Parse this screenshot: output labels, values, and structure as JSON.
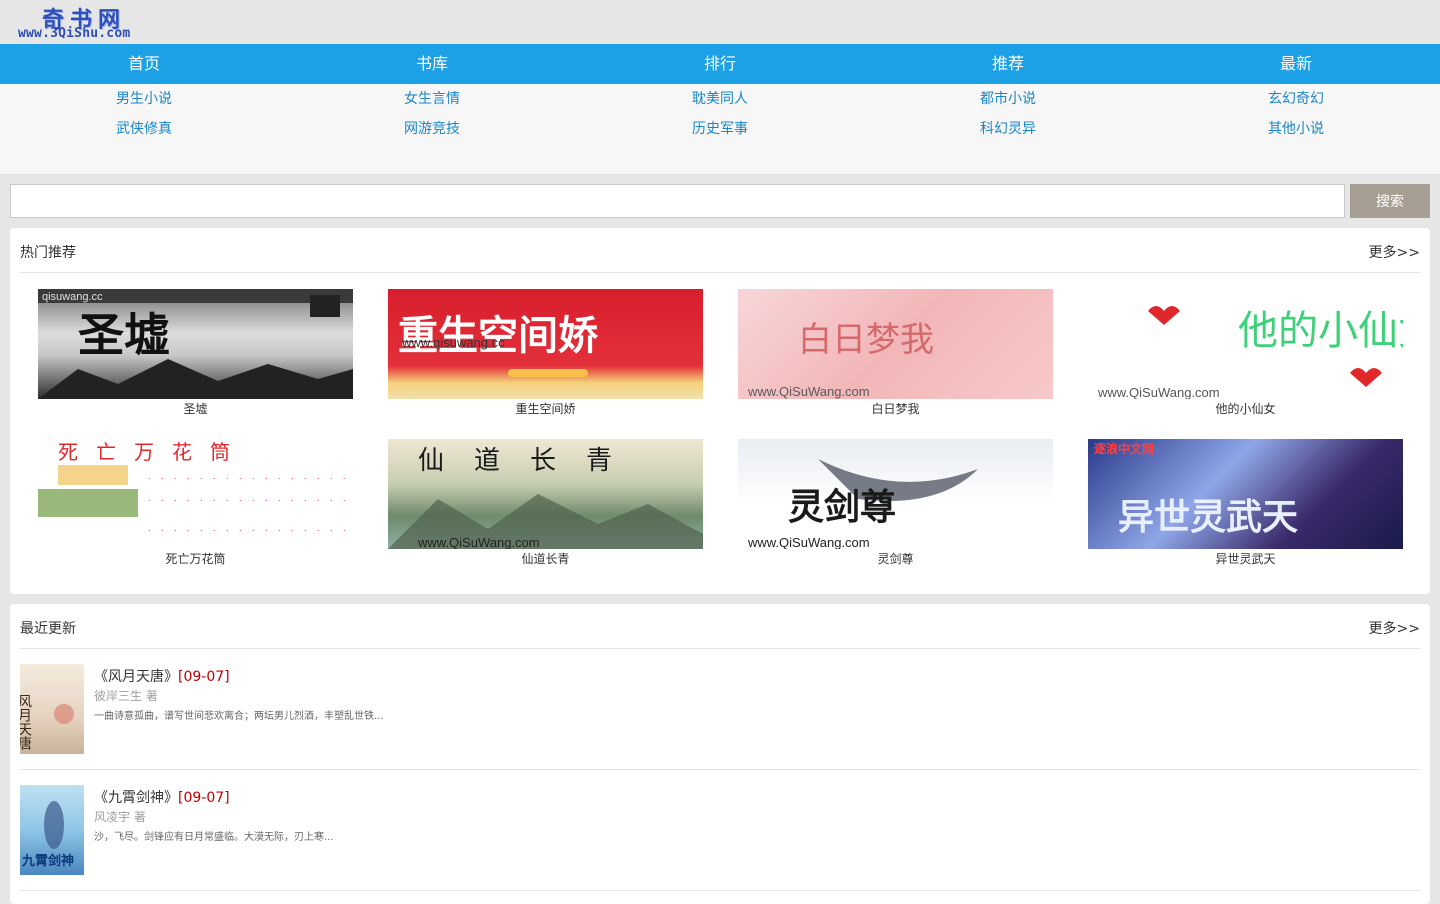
{
  "logo": {
    "cn": "奇书网",
    "url": "www.3QiShu.com"
  },
  "nav": [
    "首页",
    "书库",
    "排行",
    "推荐",
    "最新"
  ],
  "categories": [
    [
      "男生小说",
      "女生言情",
      "耽美同人",
      "都市小说",
      "玄幻奇幻"
    ],
    [
      "武侠修真",
      "网游竞技",
      "历史军事",
      "科幻灵异",
      "其他小说"
    ]
  ],
  "search": {
    "placeholder": "",
    "button": "搜索"
  },
  "hot": {
    "title": "热门推荐",
    "more": "更多>>",
    "books": [
      {
        "name": "圣墟",
        "cover_text": "圣墟",
        "cover_overlay": "qisuwang.cc"
      },
      {
        "name": "重生空间娇",
        "cover_text": "重生空间娇",
        "cover_overlay": "www.qisuwang.cc"
      },
      {
        "name": "白日梦我",
        "cover_text": "白日梦我",
        "cover_overlay": "www.QiSuWang.com"
      },
      {
        "name": "他的小仙女",
        "cover_text": "他的小仙女",
        "cover_overlay": "www.QiSuWang.com"
      },
      {
        "name": "死亡万花筒",
        "cover_text": "死亡万花筒",
        "cover_overlay": ""
      },
      {
        "name": "仙道长青",
        "cover_text": "仙道长青",
        "cover_overlay": "www.QiSuWang.com"
      },
      {
        "name": "灵剑尊",
        "cover_text": "灵剑尊",
        "cover_overlay": "www.QiSuWang.com"
      },
      {
        "name": "异世灵武天",
        "cover_text": "异世灵武天",
        "cover_overlay": "逐浪中文网"
      }
    ]
  },
  "recent": {
    "title": "最近更新",
    "more": "更多>>",
    "items": [
      {
        "title": "《风月天唐》",
        "date": "[09-07]",
        "author": "彼岸三生 著",
        "desc": "一曲诗意孤曲，谱写世间悲欢离合；两坛男儿烈酒，丰塑乱世铁...",
        "thumb_text": "风月天唐"
      },
      {
        "title": "《九霄剑神》",
        "date": "[09-07]",
        "author": "风凌宇 著",
        "desc": "沙，飞尽。剑锋应有日月常盛临。大漠无际，刃上寒...",
        "thumb_text": "九霄剑神"
      }
    ]
  },
  "colors": {
    "nav": "#1ca0e6",
    "link": "#1a86c9",
    "search_btn": "#a89f94",
    "date": "#c00000"
  }
}
